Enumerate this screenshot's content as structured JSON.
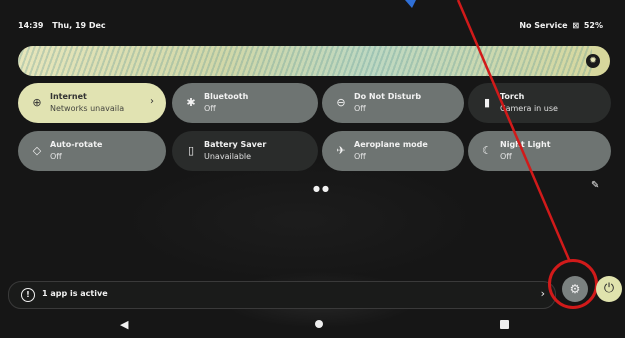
{
  "status_bar": {
    "time": "14:39",
    "date": "Thu, 19 Dec",
    "network": "No Service",
    "battery": "52%"
  },
  "brightness": {
    "level": 0.97
  },
  "tiles": [
    {
      "title": "Internet",
      "subtitle": "Networks unavaila",
      "icon": "globe-icon",
      "state": "on"
    },
    {
      "title": "Bluetooth",
      "subtitle": "Off",
      "icon": "bluetooth-icon",
      "state": "off"
    },
    {
      "title": "Do Not Disturb",
      "subtitle": "Off",
      "icon": "dnd-icon",
      "state": "off"
    },
    {
      "title": "Torch",
      "subtitle": "Camera in use",
      "icon": "flashlight-icon",
      "state": "unavailable"
    },
    {
      "title": "Auto-rotate",
      "subtitle": "Off",
      "icon": "rotate-icon",
      "state": "off"
    },
    {
      "title": "Battery Saver",
      "subtitle": "Unavailable",
      "icon": "battery-icon",
      "state": "unavailable"
    },
    {
      "title": "Aeroplane mode",
      "subtitle": "Off",
      "icon": "airplane-icon",
      "state": "off"
    },
    {
      "title": "Night Light",
      "subtitle": "Off",
      "icon": "moon-icon",
      "state": "off"
    }
  ],
  "active_apps": {
    "label": "1 app is active"
  },
  "colors": {
    "tile_active": "#e1e3b2",
    "tile_inactive": "#6e7472",
    "tile_unavailable": "#2a2c2b",
    "annotation": "#d11a1a"
  }
}
